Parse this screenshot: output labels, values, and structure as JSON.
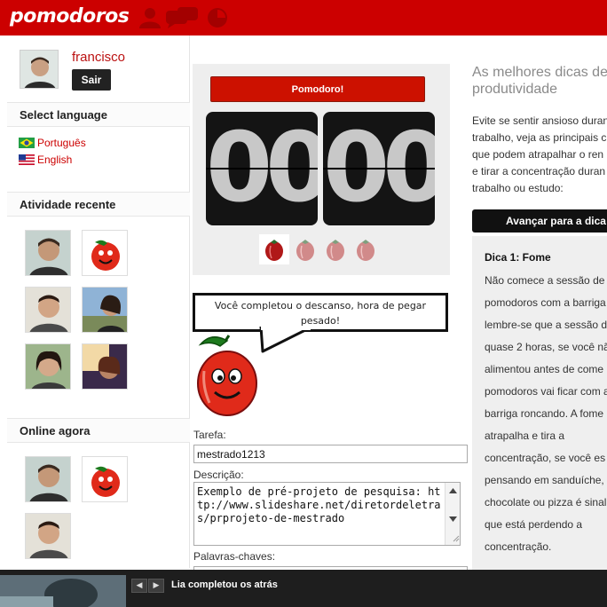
{
  "app": {
    "logo_text": "pomodoros"
  },
  "header": {
    "nav_icons": [
      "users-icon",
      "chat-icon",
      "tomato-clock-icon"
    ],
    "brand_color": "#cc0000"
  },
  "user": {
    "name": "francisco",
    "logout_label": "Sair"
  },
  "sidebar": {
    "language_title": "Select language",
    "languages": [
      {
        "label": "Português",
        "flag": "brazil-flag-icon"
      },
      {
        "label": "English",
        "flag": "us-flag-icon"
      }
    ],
    "recent_title": "Atividade recente",
    "online_title": "Online agora"
  },
  "timer": {
    "start_label": "Pomodoro!",
    "minutes": "00",
    "seconds": "00",
    "pomodoros_total": 4,
    "pomodoros_highlighted": 1
  },
  "message": {
    "text": "Você completou o descanso, hora de pegar pesado!"
  },
  "form": {
    "task_label": "Tarefa:",
    "task_value": "mestrado1213",
    "description_label": "Descrição:",
    "description_value": "Exemplo de pré-projeto de pesquisa: http://www.slideshare.net/diretordeletras/prprojeto-de-mestrado",
    "keywords_label": "Palavras-chaves:"
  },
  "tips": {
    "title": "As melhores dicas de produtividade",
    "intro": "Evite se sentir ansioso duran\ntrabalho, veja as principais c\nque podem atrapalhar o ren\ne tirar a concentração duran\ntrabalho ou estudo:",
    "button_label": "Avançar para a dica",
    "tip_heading": "Dica 1: Fome",
    "tip_body": "Não comece a sessão de\npomodoros com a barriga\nlembre-se que a sessão d\nquase 2 horas, se você nã\nalimentou antes de come\npomodoros vai ficar com a\nbarriga roncando. A fome\natrapalha e tira a\nconcentração, se você es\npensando em sanduíche,\nchocolate ou pizza é sinal\nque está perdendo a\nconcentração."
  },
  "notification": {
    "text": "Lia completou os atrás"
  }
}
